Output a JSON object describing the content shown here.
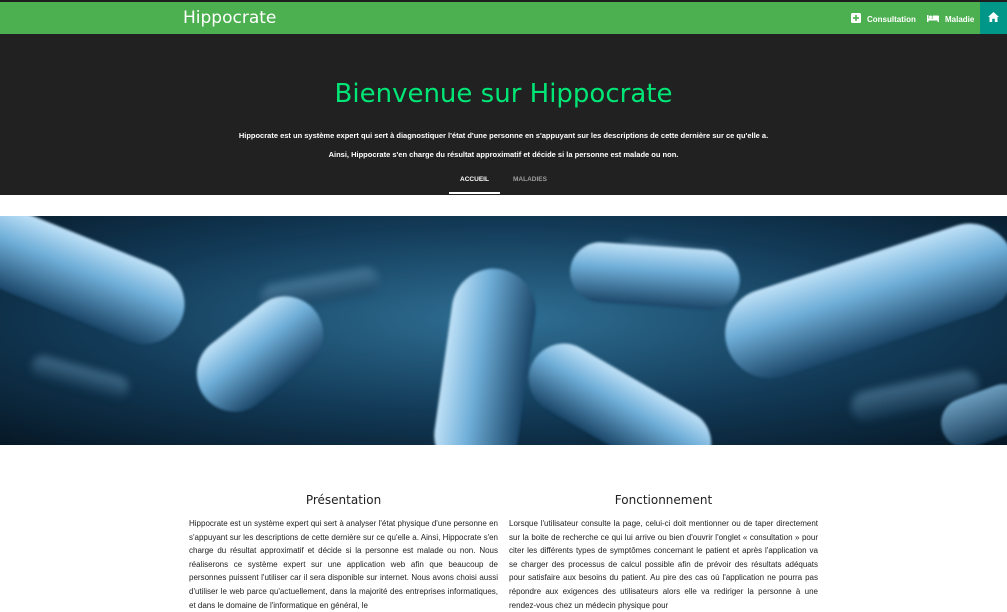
{
  "navbar": {
    "brand": "Hippocrate",
    "links": [
      {
        "label": "Consultation",
        "icon": "plus-square-icon"
      },
      {
        "label": "Maladie",
        "icon": "bed-icon"
      }
    ],
    "home_icon": "home-icon",
    "colors": {
      "bar": "#4caf50",
      "home": "#009688"
    }
  },
  "hero": {
    "title": "Bienvenue sur Hippocrate",
    "line1": "Hippocrate est un système expert qui sert à diagnostiquer l'état d'une personne en s'appuyant sur les descriptions de cette dernière sur ce qu'elle a.",
    "line2": "Ainsi, Hippocrate s'en charge du résultat approximatif et décide si la personne est malade ou non.",
    "title_color": "#00e676",
    "tabs": [
      {
        "label": "Accueil",
        "active": true
      },
      {
        "label": "Maladies",
        "active": false
      }
    ]
  },
  "banner": {
    "icon": "bacteria-image"
  },
  "presentation": {
    "title": "Présentation",
    "text": "Hippocrate est un système expert qui sert à analyser l'état physique d'une personne en s'appuyant sur les descriptions de cette dernière sur ce qu'elle a. Ainsi, Hippocrate s'en charge du résultat approximatif et décide si la personne est malade ou non. Nous réaliserons ce système expert sur une application web afin que beaucoup de personnes puissent l'utiliser car il sera disponible sur internet. Nous avons choisi aussi d'utiliser le web parce qu'actuellement, dans la majorité des entreprises informatiques, et dans le domaine de l'informatique en général, le"
  },
  "fonctionnement": {
    "title": "Fonctionnement",
    "text": "Lorsque l'utilisateur consulte la page, celui-ci doit mentionner ou de taper directement sur la boite de recherche ce qui lui arrive ou bien d'ouvrir l'onglet « consultation » pour citer les différents types de symptômes concernant le patient et après l'application va se charger des processus de calcul possible afin de prévoir des résultats adéquats pour satisfaire aux besoins du patient. Au pire des cas où l'application ne pourra pas répondre aux exigences des utilisateurs alors elle va rediriger la personne à une rendez-vous chez un médecin physique pour"
  }
}
